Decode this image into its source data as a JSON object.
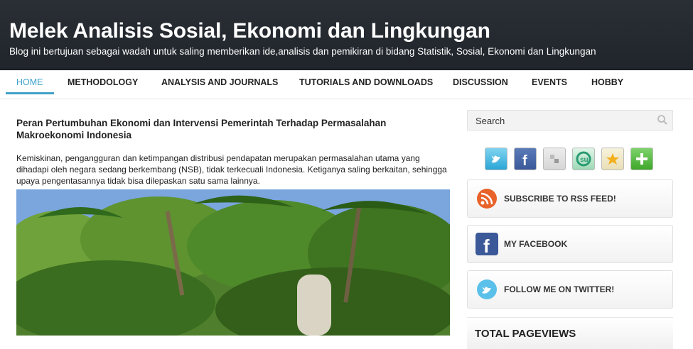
{
  "header": {
    "title": "Melek Analisis Sosial, Ekonomi dan Lingkungan",
    "description": "Blog ini bertujuan sebagai wadah untuk saling memberikan ide,analisis dan pemikiran di bidang Statistik, Sosial, Ekonomi dan Lingkungan"
  },
  "nav": {
    "items": [
      {
        "label": "HOME",
        "active": true
      },
      {
        "label": "METHODOLOGY"
      },
      {
        "label": "ANALYSIS AND JOURNALS"
      },
      {
        "label": "TUTORIALS AND DOWNLOADS"
      },
      {
        "label": "DISCUSSION"
      },
      {
        "label": "EVENTS"
      },
      {
        "label": "HOBBY"
      }
    ]
  },
  "post": {
    "title": "Peran Pertumbuhan Ekonomi dan Intervensi Pemerintah Terhadap Permasalahan Makroekonomi Indonesia",
    "excerpt": "Kemiskinan, pengangguran dan ketimpangan distribusi pendapatan merupakan permasalahan utama yang dihadapi oleh negara sedang berkembang (NSB), tidak terkecuali Indonesia. Ketiganya saling berkaitan, sehingga upaya pengentasannya tidak bisa dilepaskan satu sama lainnya."
  },
  "sidebar": {
    "search_placeholder": "Search",
    "social_icons": [
      "twitter-icon",
      "facebook-icon",
      "delicious-icon",
      "stumbleupon-icon",
      "favorite-star-icon",
      "add-plus-icon"
    ],
    "boxes": [
      {
        "label": "SUBSCRIBE TO RSS FEED!",
        "icon": "rss-icon"
      },
      {
        "label": "MY FACEBOOK",
        "icon": "facebook-icon"
      },
      {
        "label": "FOLLOW ME ON TWITTER!",
        "icon": "twitter-bird-icon"
      }
    ],
    "total_pageviews_label": "TOTAL PAGEVIEWS"
  },
  "colors": {
    "header_bg": "#23282e",
    "accent": "#3fa2c8"
  }
}
